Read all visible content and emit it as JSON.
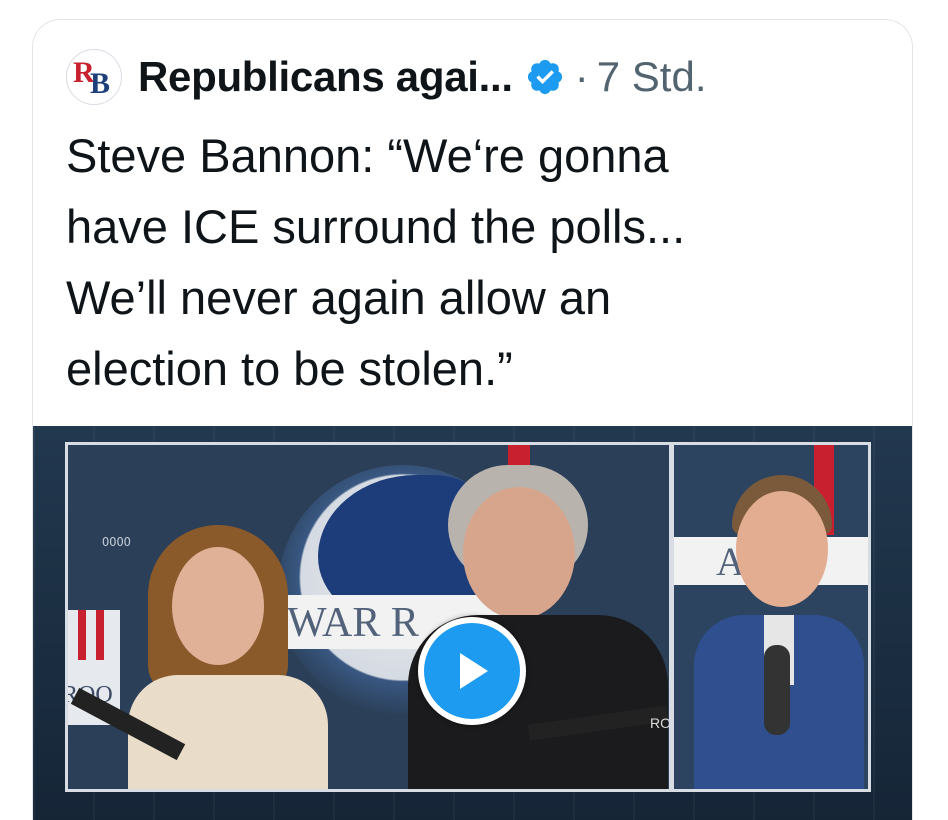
{
  "tweet": {
    "account_name": "Republicans agai...",
    "avatar_letters": {
      "r": "R",
      "b": "B"
    },
    "separator": "·",
    "time": "7 Std.",
    "text": "Steve Bannon: “We‘re gonna\nhave ICE surround the polls...\nWe’ll never again allow an\nelection to be stolen.”"
  },
  "video": {
    "banner_main": "WAR R",
    "banner_right": "AI     OO",
    "left_badge": "ROO",
    "tag": "OOOO",
    "mic_label": "RO"
  },
  "colors": {
    "verified_blue": "#1d9bf0",
    "secondary_text": "#536471",
    "play_button": "#1d9bf0"
  },
  "icons": {
    "verified": "verified-badge-icon",
    "play": "play-icon"
  }
}
